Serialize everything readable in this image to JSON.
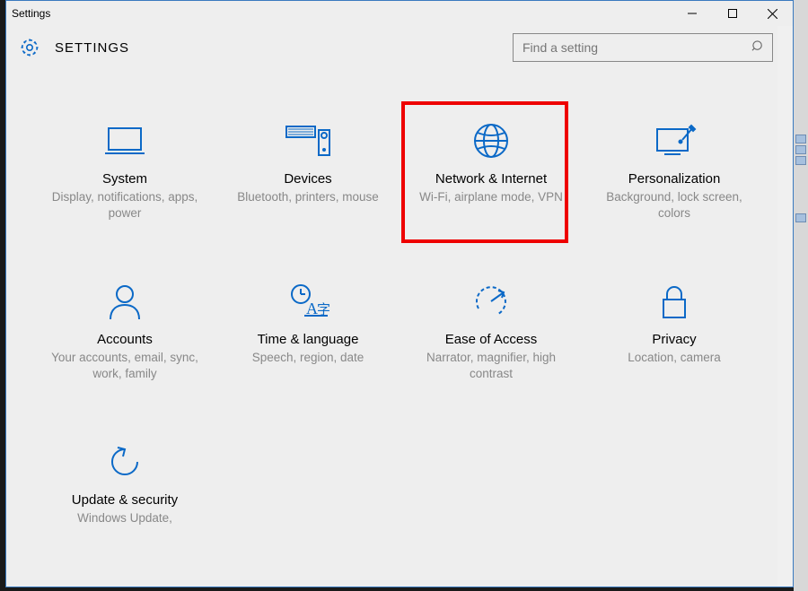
{
  "window": {
    "title": "Settings"
  },
  "header": {
    "title": "SETTINGS",
    "search_placeholder": "Find a setting"
  },
  "tiles": [
    {
      "label": "System",
      "desc": "Display, notifications, apps, power"
    },
    {
      "label": "Devices",
      "desc": "Bluetooth, printers, mouse"
    },
    {
      "label": "Network & Internet",
      "desc": "Wi-Fi, airplane mode, VPN"
    },
    {
      "label": "Personalization",
      "desc": "Background, lock screen, colors"
    },
    {
      "label": "Accounts",
      "desc": "Your accounts, email, sync, work, family"
    },
    {
      "label": "Time & language",
      "desc": "Speech, region, date"
    },
    {
      "label": "Ease of Access",
      "desc": "Narrator, magnifier, high contrast"
    },
    {
      "label": "Privacy",
      "desc": "Location, camera"
    },
    {
      "label": "Update & security",
      "desc": "Windows Update,"
    }
  ],
  "highlight_index": 2,
  "colors": {
    "accent": "#0b69c7",
    "highlight": "#ee0000"
  }
}
